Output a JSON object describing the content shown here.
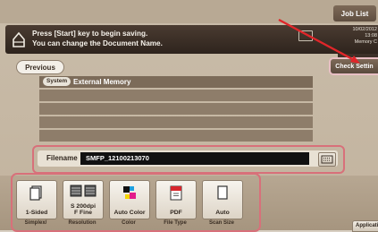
{
  "header": {
    "job_list_label": "Job List"
  },
  "message": {
    "line1": "Press [Start] key to begin saving.",
    "line2": "You can change the Document Name."
  },
  "status": {
    "date": "10/02/2012",
    "time": "13:08",
    "memory_label": "Memory",
    "memory_value": "C"
  },
  "actions": {
    "previous_label": "Previous",
    "check_settings_label": "Check Settin"
  },
  "destination": {
    "tag": "System",
    "name": "External Memory"
  },
  "filename": {
    "label": "Filename",
    "value": "SMFP_12100213070"
  },
  "tools": [
    {
      "value": "1-Sided",
      "caption": "Simplex/",
      "icon": "simplex-icon"
    },
    {
      "value": "S 200dpi\nF Fine",
      "caption": "Resolution",
      "icon": "resolution-icon"
    },
    {
      "value": "Auto Color",
      "caption": "Color",
      "icon": "color-icon"
    },
    {
      "value": "PDF",
      "caption": "File Type",
      "icon": "pdf-file-icon"
    },
    {
      "value": "Auto",
      "caption": "Scan Size",
      "icon": "scan-size-icon"
    }
  ],
  "application_label": "Applicatio",
  "colors": {
    "highlight": "#d8707a",
    "arrow": "#e0262a"
  }
}
